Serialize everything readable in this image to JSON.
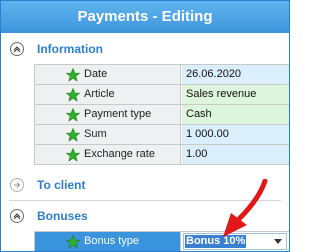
{
  "window": {
    "title": "Payments - Editing"
  },
  "sections": {
    "information": {
      "label": "Information",
      "icon": "chevron-up-circle-icon"
    },
    "to_client": {
      "label": "To client",
      "icon": "chevron-right-circle-icon"
    },
    "bonuses": {
      "label": "Bonuses",
      "icon": "chevron-up-circle-icon"
    }
  },
  "info_fields": [
    {
      "label": "Date",
      "value": "26.06.2020"
    },
    {
      "label": "Article",
      "value": "Sales revenue"
    },
    {
      "label": "Payment type",
      "value": "Cash"
    },
    {
      "label": "Sum",
      "value": "1 000.00"
    },
    {
      "label": "Exchange rate",
      "value": "1.00"
    }
  ],
  "bonus_fields": [
    {
      "label": "Bonus type",
      "value": "Bonus 10%"
    }
  ],
  "colors": {
    "accent": "#2c7fd0",
    "star": "#2fae2f",
    "annotation_arrow": "#e01818"
  }
}
